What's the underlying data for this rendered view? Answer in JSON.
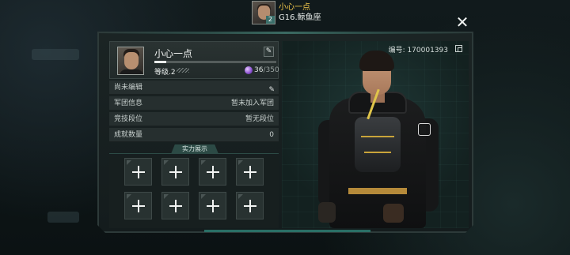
{
  "header": {
    "player_name": "小心一点",
    "server": "G16.鲸鱼座",
    "avatar_level": "2",
    "close_label": "✕"
  },
  "profile": {
    "name": "小心一点",
    "level_label": "等级.2",
    "xp_progress": 0.1,
    "gem_current": "36",
    "gem_max": "/350"
  },
  "info_rows": [
    {
      "key": "尚未编辑",
      "value": "",
      "editable": true
    },
    {
      "key": "军团信息",
      "value": "暂未加入军团"
    },
    {
      "key": "竞技段位",
      "value": "暂无段位"
    },
    {
      "key": "成就数量",
      "value": "0"
    }
  ],
  "showcase": {
    "title": "实力展示",
    "slots": [
      "slot-1",
      "slot-2",
      "slot-3",
      "slot-4",
      "slot-5",
      "slot-6",
      "slot-7",
      "slot-8"
    ]
  },
  "id_label": "编号: 170001393",
  "colors": {
    "accent_gold": "#f2c84b",
    "panel_teal": "#2c4a45",
    "frame_border": "#2d3a39"
  },
  "icons": {
    "close": "close-icon",
    "edit": "edit-icon",
    "copy": "copy-icon",
    "gem": "gem-icon",
    "add": "plus-icon"
  }
}
